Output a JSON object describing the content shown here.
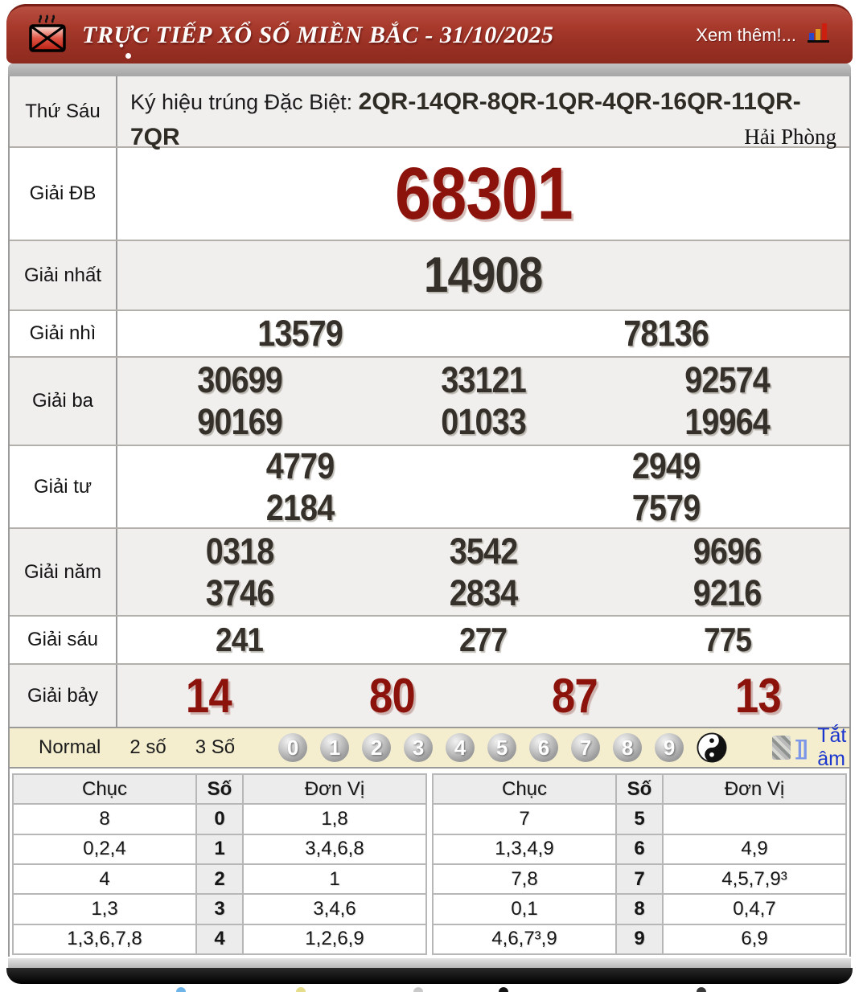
{
  "header": {
    "title": "TRỰC TIẾP XỔ SỐ MIỀN BẮC - 31/10/2025",
    "more": "Xem thêm!..."
  },
  "info": {
    "day": "Thứ Sáu",
    "symbol_label": "Ký hiệu trúng Đặc Biệt: ",
    "symbol_codes": "2QR-14QR-8QR-1QR-4QR-16QR-11QR-7QR",
    "province": "Hải Phòng"
  },
  "prizes": {
    "db": {
      "label": "Giải ĐB",
      "value": "68301"
    },
    "nhat": {
      "label": "Giải nhất",
      "value": "14908"
    },
    "nhi": {
      "label": "Giải nhì",
      "values": [
        "13579",
        "78136"
      ]
    },
    "ba": {
      "label": "Giải ba",
      "line1": [
        "30699",
        "33121",
        "92574"
      ],
      "line2": [
        "90169",
        "01033",
        "19964"
      ]
    },
    "tu": {
      "label": "Giải tư",
      "line1": [
        "4779",
        "2949"
      ],
      "line2": [
        "2184",
        "7579"
      ]
    },
    "nam": {
      "label": "Giải năm",
      "line1": [
        "0318",
        "3542",
        "9696"
      ],
      "line2": [
        "3746",
        "2834",
        "9216"
      ]
    },
    "sau": {
      "label": "Giải sáu",
      "values": [
        "241",
        "277",
        "775"
      ]
    },
    "bay": {
      "label": "Giải bảy",
      "values": [
        "14",
        "80",
        "87",
        "13"
      ]
    }
  },
  "controls": {
    "modes": [
      "Normal",
      "2 số",
      "3 Số"
    ],
    "balls": [
      "0",
      "1",
      "2",
      "3",
      "4",
      "5",
      "6",
      "7",
      "8",
      "9"
    ],
    "mute_label": "Tắt âm",
    "sound_waves": "]]"
  },
  "digit_table": {
    "headers": [
      "Chục",
      "Số",
      "Đơn Vị"
    ],
    "left": [
      [
        "8",
        "0",
        "1,8"
      ],
      [
        "0,2,4",
        "1",
        "3,4,6,8"
      ],
      [
        "4",
        "2",
        "1"
      ],
      [
        "1,3",
        "3",
        "3,4,6"
      ],
      [
        "1,3,6,7,8",
        "4",
        "1,2,6,9"
      ]
    ],
    "right": [
      [
        "7",
        "5",
        ""
      ],
      [
        "1,3,4,9",
        "6",
        "4,9"
      ],
      [
        "7,8",
        "7",
        "4,5,7,9³"
      ],
      [
        "0,1",
        "8",
        "0,4,7"
      ],
      [
        "4,6,7³,9",
        "9",
        "6,9"
      ]
    ]
  },
  "colors": {
    "header_red": "#9c3226",
    "accent_red": "#8c130b",
    "controls_cream": "#f4eecf",
    "mute_blue": "#1a36cf",
    "number_dark": "#35312a"
  }
}
